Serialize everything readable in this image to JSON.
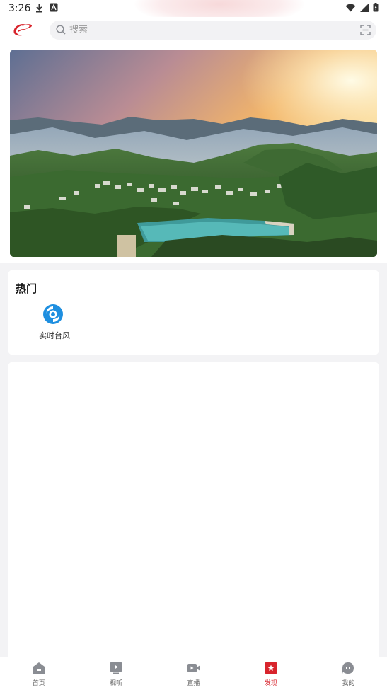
{
  "status_bar": {
    "time": "3:26"
  },
  "header": {
    "search": {
      "placeholder": "搜索"
    }
  },
  "hot": {
    "title": "热门",
    "items": [
      {
        "label": "实时台风",
        "icon": "typhoon-icon"
      }
    ]
  },
  "tabbar": {
    "active_index": 3,
    "items": [
      {
        "label": "首页",
        "icon": "home-icon"
      },
      {
        "label": "视听",
        "icon": "tv-icon"
      },
      {
        "label": "直播",
        "icon": "live-camera-icon"
      },
      {
        "label": "发现",
        "icon": "discover-star-icon"
      },
      {
        "label": "我的",
        "icon": "profile-icon"
      }
    ]
  },
  "colors": {
    "accent": "#d8242c",
    "tab_inactive": "#8a8d93",
    "typhoon": "#1e8fe0"
  }
}
